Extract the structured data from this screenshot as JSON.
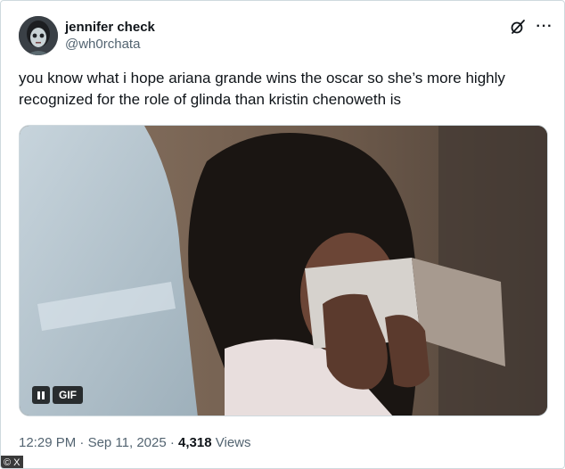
{
  "author": {
    "display_name": "jennifer check",
    "handle": "@wh0rchata"
  },
  "header_icons": [
    "grok-slash-icon",
    "more-icon"
  ],
  "more_label": "···",
  "tweet": {
    "text": "you know what i hope ariana grande wins the oscar so she’s more highly recognized for the role of glinda than kristin chenoweth is"
  },
  "media": {
    "type": "gif",
    "gif_label": "GIF"
  },
  "meta": {
    "time": "12:29 PM",
    "separator": "·",
    "date": "Sep 11, 2025",
    "views_count": "4,318",
    "views_label": "Views"
  },
  "watermark": "© X",
  "colors": {
    "text_primary": "#0f1419",
    "text_secondary": "#536471",
    "border": "#cfd9de"
  }
}
